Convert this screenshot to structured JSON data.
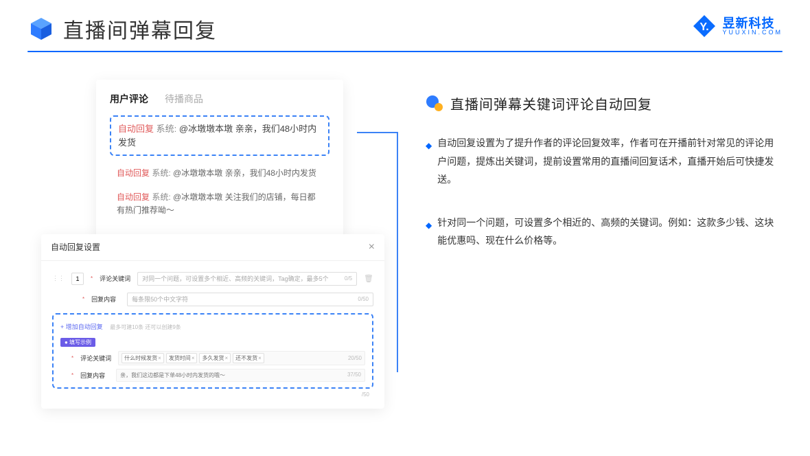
{
  "header": {
    "title": "直播间弹幕回复"
  },
  "logo": {
    "cn": "昱新科技",
    "en": "YUUXIN.COM"
  },
  "commentsPanel": {
    "tab1": "用户评论",
    "tab2": "待播商品",
    "replyTag": "自动回复",
    "sysTag": "系统:",
    "item1": "@冰墩墩本墩 亲亲，我们48小时内发货",
    "item2": "@冰墩墩本墩 亲亲，我们48小时内发货",
    "item3": "@冰墩墩本墩 关注我们的店铺，每日都有热门推荐呦～"
  },
  "settingsPanel": {
    "title": "自动回复设置",
    "idx": "1",
    "labelKw": "评论关键词",
    "phKw": "对同一个问题，可设置多个相近、高频的关键词，Tag确定，最多5个",
    "countKw": "0/5",
    "labelReply": "回复内容",
    "phReply": "每条限50个中文字符",
    "countReply": "0/50",
    "addLink": "+ 增加自动回复",
    "addHint": "最多可建10条 还可以创建9条",
    "exBadge": "● 填写示例",
    "exKwLabel": "评论关键词",
    "tag1": "什么时候发货",
    "tag2": "发货时间",
    "tag3": "多久发货",
    "tag4": "还不发货",
    "exKwCount": "20/50",
    "exReplyLabel": "回复内容",
    "exReplyText": "亲，我们这边都是下单48小时内发货的哦～",
    "exReplyCount": "37/50",
    "trailCount": "/50"
  },
  "right": {
    "sectionTitle": "直播间弹幕关键词评论自动回复",
    "b1": "自动回复设置为了提升作者的评论回复效率，作者可在开播前针对常见的评论用户问题，提炼出关键词，提前设置常用的直播间回复话术，直播开始后可快捷发送。",
    "b2": "针对同一个问题，可设置多个相近的、高频的关键词。例如：这款多少钱、这块能优惠吗、现在什么价格等。"
  }
}
